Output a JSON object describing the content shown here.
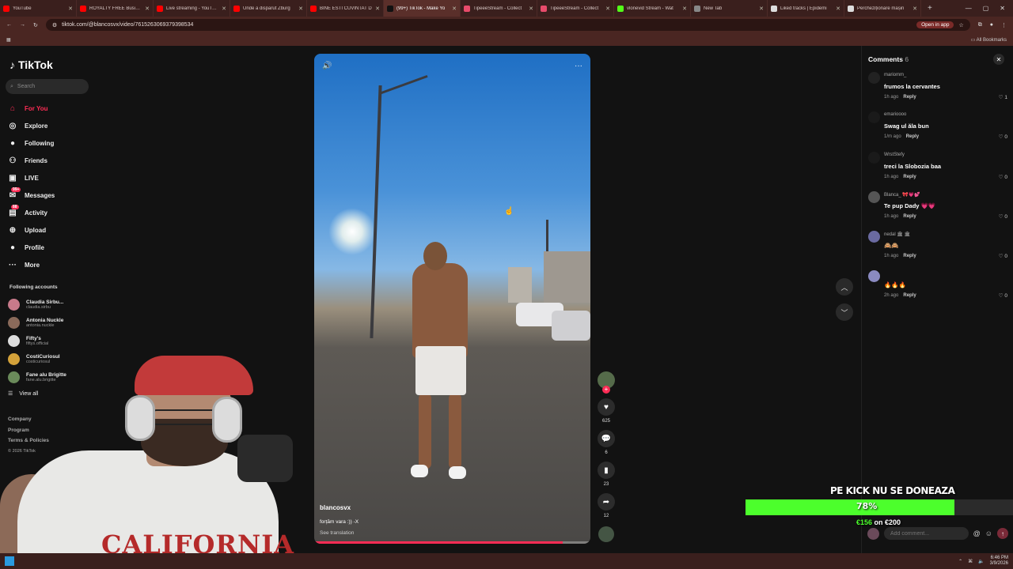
{
  "browser": {
    "tabs": [
      {
        "title": "YouTube",
        "color": "#ff0000",
        "active": false
      },
      {
        "title": "ROYALTY FREE Business",
        "color": "#ff0000",
        "active": false
      },
      {
        "title": "Live streaming - YouTube",
        "color": "#ff0000",
        "active": false
      },
      {
        "title": "Unde a dispărut Zburg",
        "color": "#ff0000",
        "active": false
      },
      {
        "title": "BINE ESTI CUVINTAT D",
        "color": "#ff0000",
        "active": false
      },
      {
        "title": "(99+) TikTok - Make Yo",
        "color": "#111111",
        "active": true
      },
      {
        "title": "TipeeeStream - Collect",
        "color": "#e84b6b",
        "active": false
      },
      {
        "title": "TipeeeStream - Collect",
        "color": "#e84b6b",
        "active": false
      },
      {
        "title": "vlonevid Stream - Wat",
        "color": "#53fc18",
        "active": false
      },
      {
        "title": "New Tab",
        "color": "#888888",
        "active": false
      },
      {
        "title": "Liked tracks | Epidemi",
        "color": "#dddddd",
        "active": false
      },
      {
        "title": "Percheziționare mașin",
        "color": "#dddddd",
        "active": false
      }
    ],
    "new_tab": "+",
    "url": "tiktok.com/@blancosvx/video/7615263069379398534",
    "open_in_app": "Open in app",
    "all_bookmarks": "All Bookmarks"
  },
  "sidebar": {
    "logo": "TikTok",
    "search_placeholder": "Search",
    "nav": [
      {
        "label": "For You",
        "icon": "home-icon",
        "glyph": "⌂",
        "active": true,
        "badge": ""
      },
      {
        "label": "Explore",
        "icon": "compass-icon",
        "glyph": "◎",
        "active": false,
        "badge": ""
      },
      {
        "label": "Following",
        "icon": "following-avatar-icon",
        "glyph": "●",
        "active": false,
        "badge": ""
      },
      {
        "label": "Friends",
        "icon": "friends-icon",
        "glyph": "⚇",
        "active": false,
        "badge": ""
      },
      {
        "label": "LIVE",
        "icon": "live-icon",
        "glyph": "▣",
        "active": false,
        "badge": ""
      },
      {
        "label": "Messages",
        "icon": "messages-icon",
        "glyph": "✉",
        "active": false,
        "badge": "99+"
      },
      {
        "label": "Activity",
        "icon": "activity-icon",
        "glyph": "▤",
        "active": false,
        "badge": "88"
      },
      {
        "label": "Upload",
        "icon": "upload-icon",
        "glyph": "⊕",
        "active": false,
        "badge": ""
      },
      {
        "label": "Profile",
        "icon": "profile-avatar-icon",
        "glyph": "●",
        "active": false,
        "badge": ""
      },
      {
        "label": "More",
        "icon": "more-icon",
        "glyph": "···",
        "active": false,
        "badge": ""
      }
    ],
    "following_title": "Following accounts",
    "following": [
      {
        "name": "Claudia Sirbu...",
        "handle": "claudia.sirbu",
        "color": "#c87a8a"
      },
      {
        "name": "Antonia Nuckle",
        "handle": "antonia.nuckle",
        "color": "#8a6a5a"
      },
      {
        "name": "Fifty's",
        "handle": "fiftys.official",
        "color": "#dddddd"
      },
      {
        "name": "CostiCuriosul",
        "handle": "costicuriosul",
        "color": "#d4a23a"
      },
      {
        "name": "Fane alu Brigitte",
        "handle": "fane.alu.brigitte",
        "color": "#6a8a5a"
      }
    ],
    "view_all": "View all",
    "footer": {
      "company": "Company",
      "program": "Program",
      "terms": "Terms & Policies",
      "copyright": "© 2026 TikTok"
    }
  },
  "video": {
    "username": "blancosvx",
    "caption": "forțăm vara :)) -X",
    "translate": "See translation",
    "progress_fraction": 0.9
  },
  "actions": {
    "likes": "625",
    "comments": "6",
    "saves": "23",
    "shares": "12"
  },
  "comments_panel": {
    "title": "Comments",
    "count": "6",
    "reply_label": "Reply",
    "input_placeholder": "Add comment...",
    "items": [
      {
        "user": "mariomm_",
        "text": "frumos la cervantes",
        "time": "1h ago",
        "likes": "1",
        "avatar_color": "#222222"
      },
      {
        "user": "emarioooo",
        "text": "Swag ul ăla bun",
        "time": "1/m ago",
        "likes": "0",
        "avatar_color": "#1a1a1a"
      },
      {
        "user": "WrstStefy",
        "text": "treci la Slobozia baa",
        "time": "1h ago",
        "likes": "0",
        "avatar_color": "#1a1a1a"
      },
      {
        "user": "Blanca_ 🎀💗💕",
        "text": "Te pup Dady 💗💗",
        "time": "1h ago",
        "likes": "0",
        "avatar_color": "#555555"
      },
      {
        "user": "nedal 🏛 🏛",
        "text": "🙈🙈",
        "time": "1h ago",
        "likes": "0",
        "avatar_color": "#6a6aa0"
      },
      {
        "user": "",
        "text": "🔥🔥🔥",
        "time": "2h ago",
        "likes": "0",
        "avatar_color": "#8a8ac0"
      }
    ]
  },
  "donation": {
    "title": "PE KICK NU SE DONEAZA",
    "percent_label": "78%",
    "fraction": 0.78,
    "amount": "€156",
    "goal_text": "on €200",
    "bar_color": "#4cff2c"
  },
  "webcam": {
    "shirt_text": "CALIFORNIA"
  },
  "taskbar": {
    "time": "6:46 PM",
    "date": "3/9/2026"
  }
}
